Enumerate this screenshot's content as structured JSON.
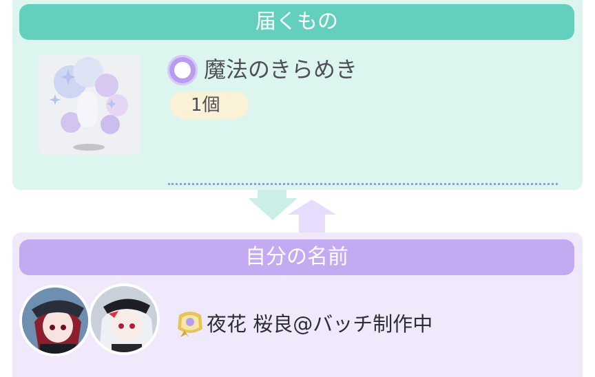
{
  "delivery": {
    "header": "届くもの",
    "item_name": "魔法のきらめき",
    "quantity": "1個",
    "item_icon": "sparkle-badge-icon",
    "thumbnail": "magic-sparkle-bubbles-image"
  },
  "transfer": {
    "arrows_icon": "swap-arrows-icon",
    "down_arrow_color": "#cbeee6",
    "up_arrow_color": "#e6dcfb"
  },
  "sender": {
    "header": "自分の名前",
    "user_name": "夜花 桜良@バッチ制作中",
    "badge_icon": "gold-ribbon-badge-icon",
    "avatars": [
      "avatar-red-hair",
      "avatar-white-hair"
    ]
  },
  "colors": {
    "top_panel_bg": "#dcf5ef",
    "top_header": "#63cfbd",
    "bottom_panel_bg": "#efe9fb",
    "bottom_header": "#c3aaf1",
    "quantity_pill": "#fbf1d6",
    "dotted_line": "#8f9fd8"
  }
}
